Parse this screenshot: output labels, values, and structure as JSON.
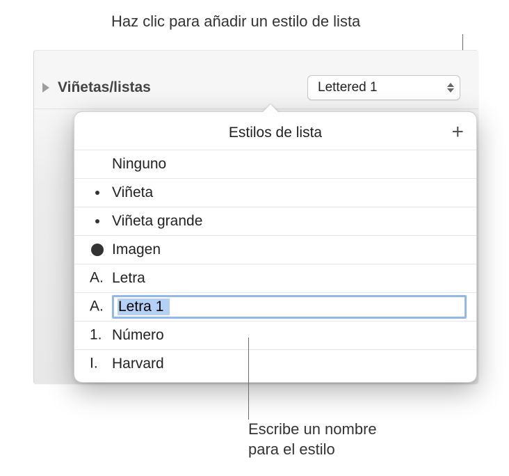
{
  "callouts": {
    "top": "Haz clic para añadir un estilo de lista",
    "bottom_line1": "Escribe un nombre",
    "bottom_line2": "para el estilo"
  },
  "section": {
    "label": "Viñetas/listas"
  },
  "popup": {
    "value": "Lettered 1"
  },
  "popover": {
    "title": "Estilos de lista",
    "add_glyph": "+",
    "editing_value": "Letra 1",
    "items": {
      "none": "Ninguno",
      "bullet": "Viñeta",
      "big_bullet": "Viñeta grande",
      "image": "Imagen",
      "letter": "Letra",
      "letter1": "Letra 1",
      "number": "Número",
      "harvard": "Harvard"
    },
    "prefixes": {
      "letter": "A.",
      "number": "1.",
      "roman": "I."
    }
  }
}
